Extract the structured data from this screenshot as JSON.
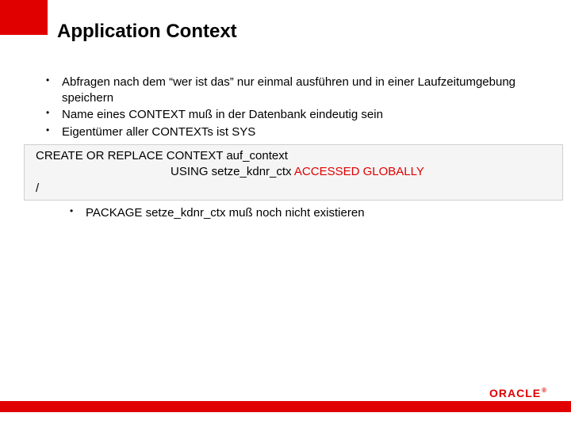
{
  "title": "Application Context",
  "bullets": [
    "Abfragen nach dem “wer ist das” nur einmal ausführen und in einer Laufzeitumgebung speichern",
    "Name eines CONTEXT muß in der Datenbank eindeutig sein",
    "Eigentümer aller CONTEXTs ist SYS"
  ],
  "code": {
    "line1": "CREATE OR REPLACE CONTEXT auf_context",
    "line2_plain": "USING setze_kdnr_ctx ",
    "line2_red": "ACCESSED GLOBALLY",
    "line3": "/"
  },
  "sub_bullets": [
    "PACKAGE setze_kdnr_ctx muß noch nicht existieren"
  ],
  "logo": {
    "text": "ORACLE",
    "reg": "®"
  }
}
